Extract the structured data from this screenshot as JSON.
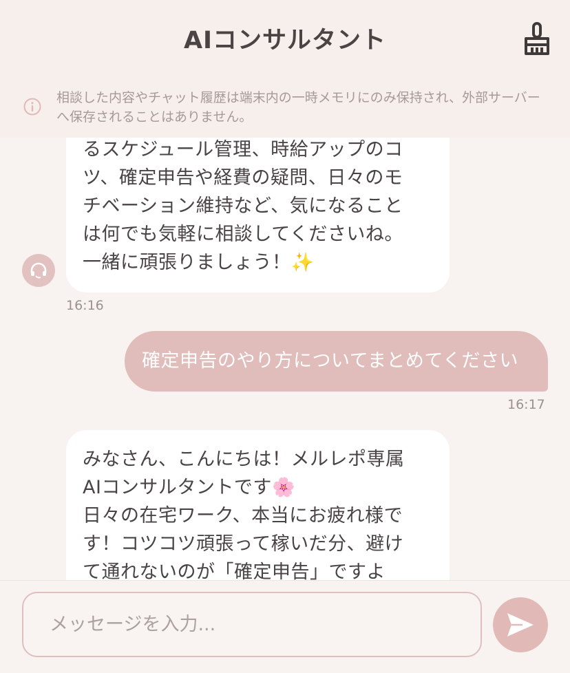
{
  "header": {
    "title": "AIコンサルタント",
    "clear_icon": "broom-icon"
  },
  "notice": {
    "icon": "info-icon",
    "text": "相談した内容やチャット履歴は端末内の一時メモリにのみ保持され、外部サーバーへ保存されることはありません。"
  },
  "messages": [
    {
      "role": "assistant",
      "lines": [
        "るスケジュール管理、時給アップのコ",
        "ツ、確定申告や経費の疑問、日々のモ",
        "チベーション維持など、気になること",
        "は何でも気軽に相談してくださいね。",
        "一緒に頑張りましょう！"
      ],
      "emoji": "✨",
      "time": "16:16"
    },
    {
      "role": "user",
      "text": "確定申告のやり方についてまとめてください",
      "time": "16:17"
    },
    {
      "role": "assistant",
      "lines": [
        "みなさん、こんにちは！メルレポ専属",
        "AIコンサルタントです",
        "日々の在宅ワーク、本当にお疲れ様で",
        "す！コツコツ頑張って稼いだ分、避け",
        "て通れないのが「確定申告」ですよ"
      ],
      "emoji": "🌸"
    }
  ],
  "composer": {
    "placeholder": "メッセージを入力...",
    "send_icon": "send-icon"
  },
  "colors": {
    "accent": "#e1b9b7",
    "user_bubble": "#e0bcba",
    "background": "#f8f3f1",
    "header_bg": "#f6efec"
  }
}
